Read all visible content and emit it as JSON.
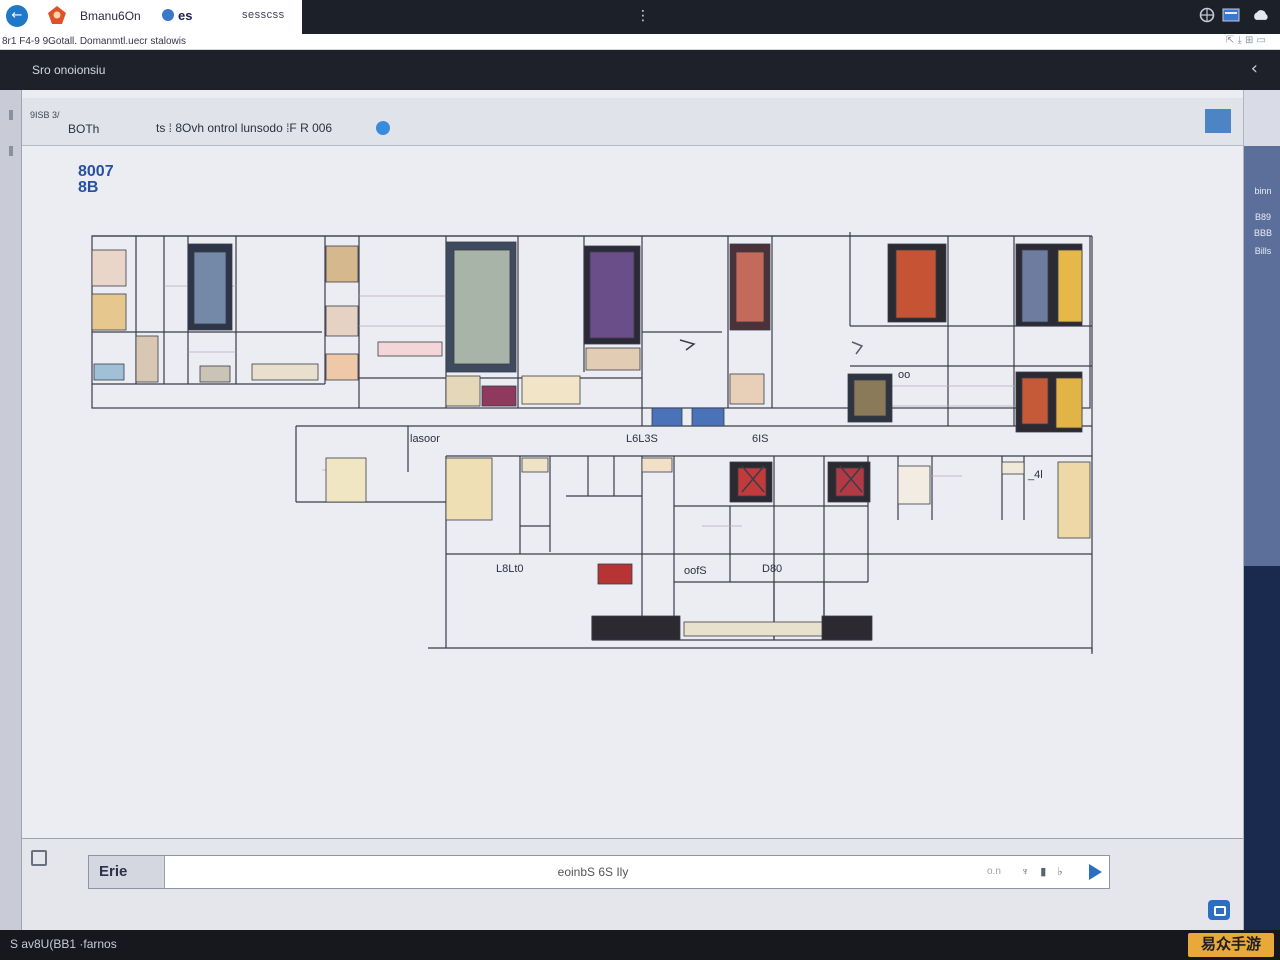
{
  "browser": {
    "back_icon": "arrow-left-icon",
    "tab_title": "Bmanu6On",
    "tab_sub": "es",
    "tab_extra": "sesscss",
    "center_icon": "grip-icon",
    "url": "8r1 F4-9   9Gotall. Domanmtl.uecr stalowis",
    "url_right": "⇱ ⤓ ⊞ ▭"
  },
  "app": {
    "title": "Sro onoionsiu",
    "collapse_icon": "chevron-left-icon"
  },
  "toolbar": {
    "small_label": "9ISB 3/",
    "name": "BOTh",
    "path": "ts  ⁞ 8Ovh ontrol lunsodo  ⁞F R 006"
  },
  "canvas": {
    "label": "8007\n8B",
    "annotations": [
      "lasoor",
      "L6L3S",
      "6IS",
      "L8Lt0",
      "oofS",
      "D80",
      "oo",
      "_4l"
    ]
  },
  "right_dock": {
    "items": [
      "binn",
      "B89",
      "BBB",
      "Bills"
    ]
  },
  "composer": {
    "label": "Erie",
    "input_value": "eoinbS 6S Ily",
    "hint": "o.n",
    "tools": "♆ ▮ ♭",
    "send_icon": "send-icon"
  },
  "status": {
    "text": "S av8U(BB1 ·farnos",
    "watermark": "易众手游"
  },
  "colors": {
    "accent": "#2a6fc0",
    "dock": "#5b6f9a",
    "header": "#1e2129"
  }
}
